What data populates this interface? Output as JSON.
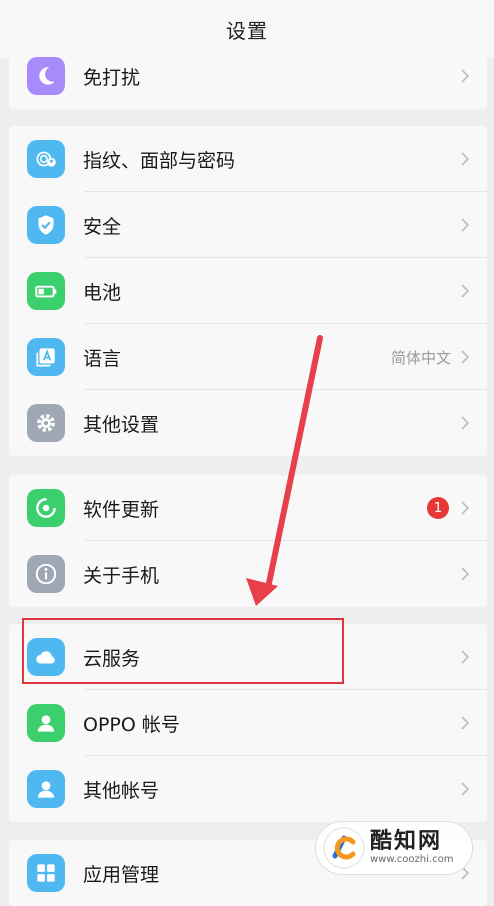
{
  "header": {
    "title": "设置"
  },
  "groups": [
    {
      "items": [
        {
          "label": "免打扰",
          "icon": "moon-icon",
          "color": "#a78bfa"
        }
      ]
    },
    {
      "items": [
        {
          "label": "指纹、面部与密码",
          "icon": "fingerprint-face-icon",
          "color": "#4fb8f0"
        },
        {
          "label": "安全",
          "icon": "shield-check-icon",
          "color": "#4fb8f0"
        },
        {
          "label": "电池",
          "icon": "battery-icon",
          "color": "#3ccf6e"
        },
        {
          "label": "语言",
          "icon": "language-icon",
          "color": "#4fb8f0",
          "value": "简体中文"
        },
        {
          "label": "其他设置",
          "icon": "gear-icon",
          "color": "#9ea7b3"
        }
      ]
    },
    {
      "items": [
        {
          "label": "软件更新",
          "icon": "refresh-icon",
          "color": "#3ccf6e",
          "badge": "1"
        },
        {
          "label": "关于手机",
          "icon": "info-icon",
          "color": "#9ea7b3"
        }
      ]
    },
    {
      "items": [
        {
          "label": "云服务",
          "icon": "cloud-icon",
          "color": "#4fb8f0"
        },
        {
          "label": "OPPO 帐号",
          "icon": "user-icon",
          "color": "#3ccf6e"
        },
        {
          "label": "其他帐号",
          "icon": "user-icon",
          "color": "#4fb8f0"
        }
      ]
    },
    {
      "items": [
        {
          "label": "应用管理",
          "icon": "apps-grid-icon",
          "color": "#4fb8f0"
        }
      ]
    }
  ],
  "watermark": {
    "name": "酷知网",
    "url": "www.coozhi.com"
  },
  "annotation": {
    "color": "#d9363e"
  }
}
